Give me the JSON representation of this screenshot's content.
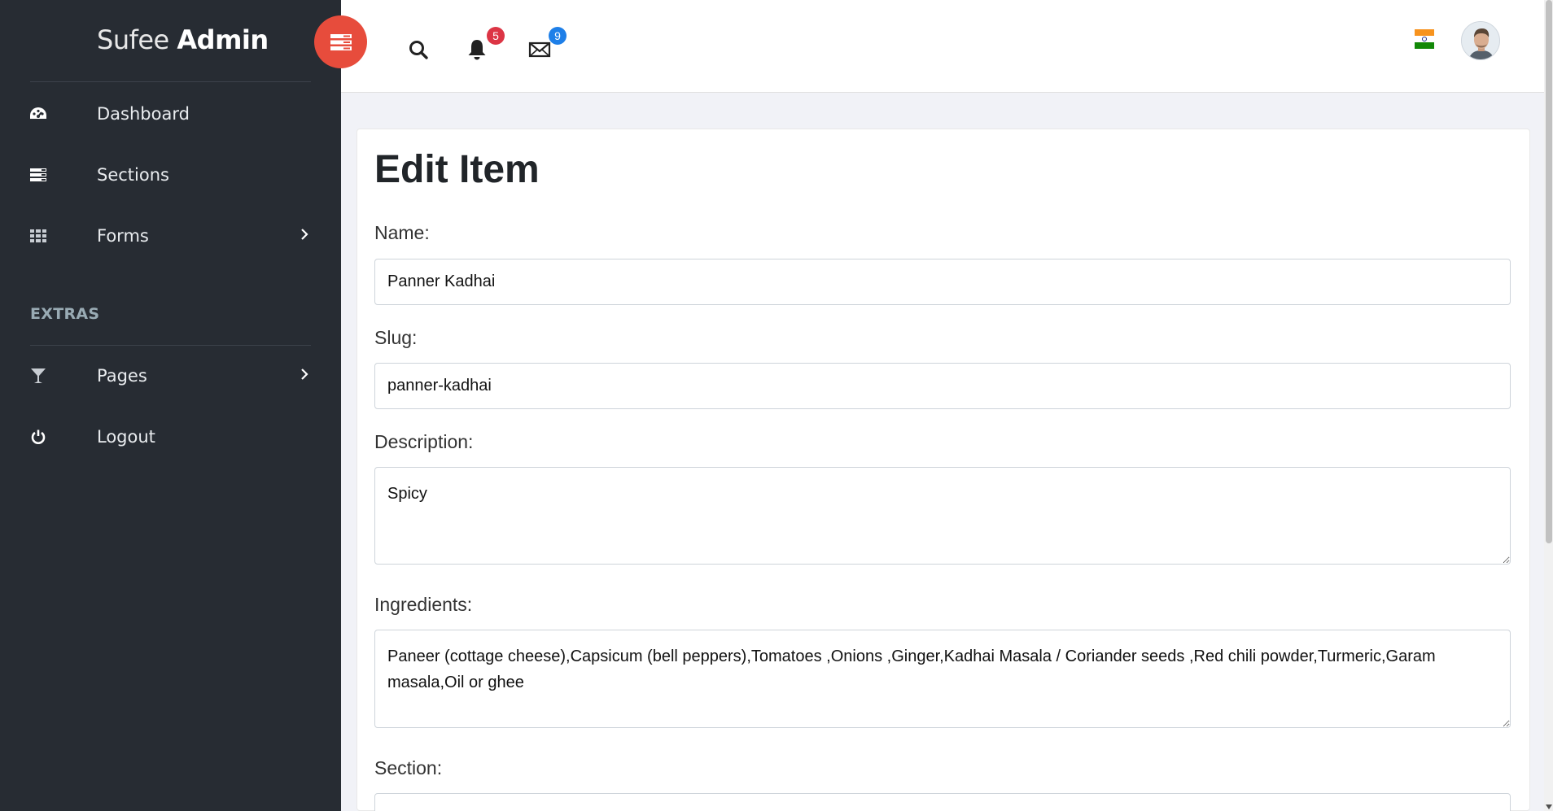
{
  "brand": {
    "light": "Sufee",
    "bold": "Admin"
  },
  "sidebar": {
    "items": [
      {
        "label": "Dashboard",
        "icon": "dashboard-icon"
      },
      {
        "label": "Sections",
        "icon": "sections-icon"
      },
      {
        "label": "Forms",
        "icon": "grid-icon"
      }
    ],
    "extras_heading": "EXTRAS",
    "extras_items": [
      {
        "label": "Pages",
        "icon": "glass-icon"
      },
      {
        "label": "Logout",
        "icon": "power-icon"
      }
    ]
  },
  "header": {
    "notifications_count": "5",
    "messages_count": "9",
    "accent_color": "#e74c3c"
  },
  "form": {
    "title": "Edit Item",
    "name_label": "Name:",
    "name_value": "Panner Kadhai",
    "slug_label": "Slug:",
    "slug_value": "panner-kadhai",
    "description_label": "Description:",
    "description_value": "Spicy",
    "ingredients_label": "Ingredients:",
    "ingredients_value": "Paneer (cottage cheese),Capsicum (bell peppers),Tomatoes ,Onions ,Ginger,Kadhai Masala / Coriander seeds ,Red chili powder,Turmeric,Garam masala,Oil or ghee",
    "section_label": "Section:"
  }
}
